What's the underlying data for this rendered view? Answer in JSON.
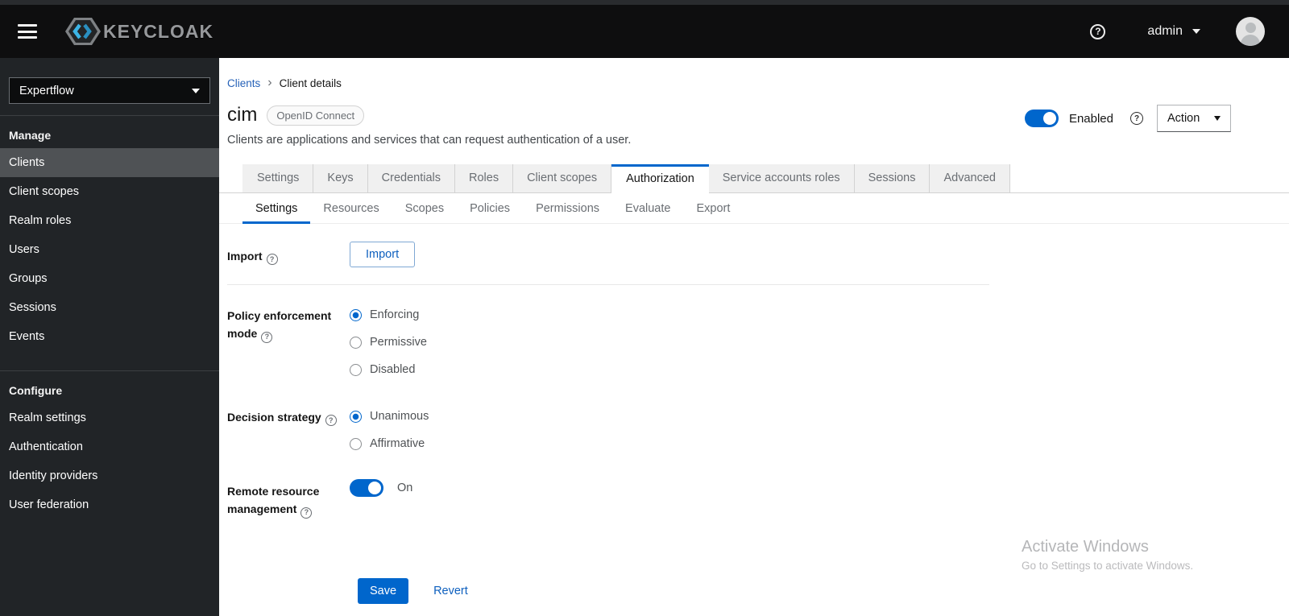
{
  "header": {
    "brand": "KEYCLOAK",
    "username": "admin"
  },
  "sidebar": {
    "realm_selector": "Expertflow",
    "groups": [
      {
        "label": "Manage",
        "items": [
          {
            "label": "Clients",
            "active": true
          },
          {
            "label": "Client scopes",
            "active": false
          },
          {
            "label": "Realm roles",
            "active": false
          },
          {
            "label": "Users",
            "active": false
          },
          {
            "label": "Groups",
            "active": false
          },
          {
            "label": "Sessions",
            "active": false
          },
          {
            "label": "Events",
            "active": false
          }
        ]
      },
      {
        "label": "Configure",
        "items": [
          {
            "label": "Realm settings",
            "active": false
          },
          {
            "label": "Authentication",
            "active": false
          },
          {
            "label": "Identity providers",
            "active": false
          },
          {
            "label": "User federation",
            "active": false
          }
        ]
      }
    ]
  },
  "main": {
    "breadcrumb": {
      "link": "Clients",
      "current": "Client details"
    },
    "title": "cim",
    "badge": "OpenID Connect",
    "description": "Clients are applications and services that can request authentication of a user.",
    "enabled_toggle": {
      "label": "Enabled",
      "state": "on"
    },
    "action_button": "Action",
    "tabs": {
      "active": "Authorization",
      "items": [
        "Settings",
        "Keys",
        "Credentials",
        "Roles",
        "Client scopes",
        "Authorization",
        "Service accounts roles",
        "Sessions",
        "Advanced"
      ]
    },
    "subtabs": {
      "active": "Settings",
      "items": [
        "Settings",
        "Resources",
        "Scopes",
        "Policies",
        "Permissions",
        "Evaluate",
        "Export"
      ]
    },
    "form": {
      "import": {
        "label": "Import",
        "button": "Import"
      },
      "policy_enforcement": {
        "label": "Policy enforcement mode",
        "selected": "Enforcing",
        "options": [
          "Enforcing",
          "Permissive",
          "Disabled"
        ]
      },
      "decision_strategy": {
        "label": "Decision strategy",
        "selected": "Unanimous",
        "options": [
          "Unanimous",
          "Affirmative"
        ]
      },
      "remote_resource": {
        "label": "Remote resource management",
        "state": "On",
        "toggle": "on"
      },
      "save_button": "Save",
      "revert_button": "Revert"
    }
  },
  "watermark": {
    "line1": "Activate Windows",
    "line2": "Go to Settings to activate Windows."
  },
  "colors": {
    "accent_blue": "#0066cc",
    "header_bg": "#0e0e0f",
    "sidebar_bg": "#212427",
    "sidebar_selected": "#4f5255",
    "tab_inactive_bg": "#f0f0f0",
    "logo_cyan": "#3cb4e5"
  }
}
